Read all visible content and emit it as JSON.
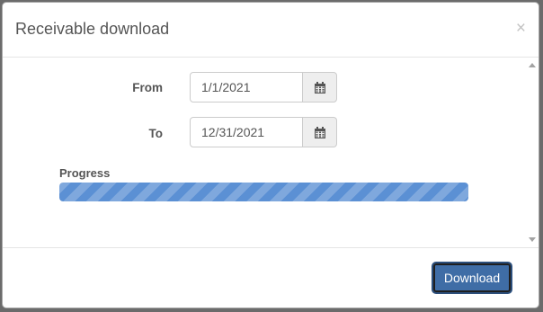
{
  "dialog": {
    "title": "Receivable download",
    "close_symbol": "×"
  },
  "form": {
    "from": {
      "label": "From",
      "value": "1/1/2021",
      "icon": "calendar-icon"
    },
    "to": {
      "label": "To",
      "value": "12/31/2021",
      "icon": "calendar-icon"
    }
  },
  "progress": {
    "label": "Progress",
    "fraction": 1.0,
    "color": "#5b90d4"
  },
  "footer": {
    "download_label": "Download",
    "button_color": "#3f6da6"
  }
}
